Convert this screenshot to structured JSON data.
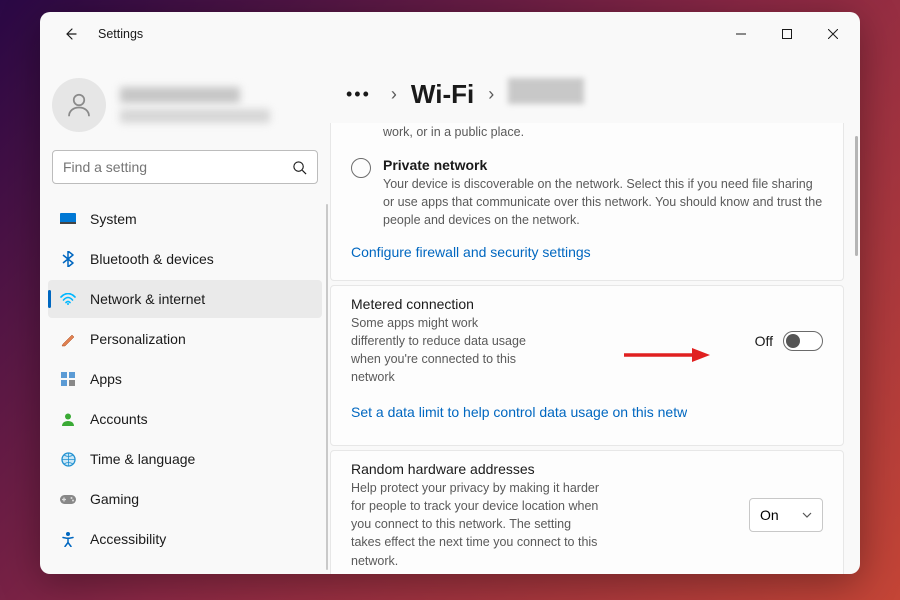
{
  "titlebar": {
    "app_title": "Settings"
  },
  "search": {
    "placeholder": "Find a setting"
  },
  "sidebar": {
    "items": [
      {
        "label": "System"
      },
      {
        "label": "Bluetooth & devices"
      },
      {
        "label": "Network & internet"
      },
      {
        "label": "Personalization"
      },
      {
        "label": "Apps"
      },
      {
        "label": "Accounts"
      },
      {
        "label": "Time & language"
      },
      {
        "label": "Gaming"
      },
      {
        "label": "Accessibility"
      }
    ],
    "active_index": 2
  },
  "breadcrumb": {
    "item_wifi": "Wi‑Fi"
  },
  "network_profile": {
    "public_desc_tail": "work, or in a public place.",
    "private_title": "Private network",
    "private_desc": "Your device is discoverable on the network. Select this if you need file sharing or use apps that communicate over this network. You should know and trust the people and devices on the network.",
    "configure_link": "Configure firewall and security settings"
  },
  "metered": {
    "title": "Metered connection",
    "desc": "Some apps might work differently to reduce data usage when you're connected to this network",
    "toggle_label": "Off",
    "data_limit_link": "Set a data limit to help control data usage on this netw"
  },
  "random_hw": {
    "title": "Random hardware addresses",
    "desc": "Help protect your privacy by making it harder for people to track your device location when you connect to this network. The setting takes effect the next time you connect to this network.",
    "dropdown_value": "On"
  }
}
